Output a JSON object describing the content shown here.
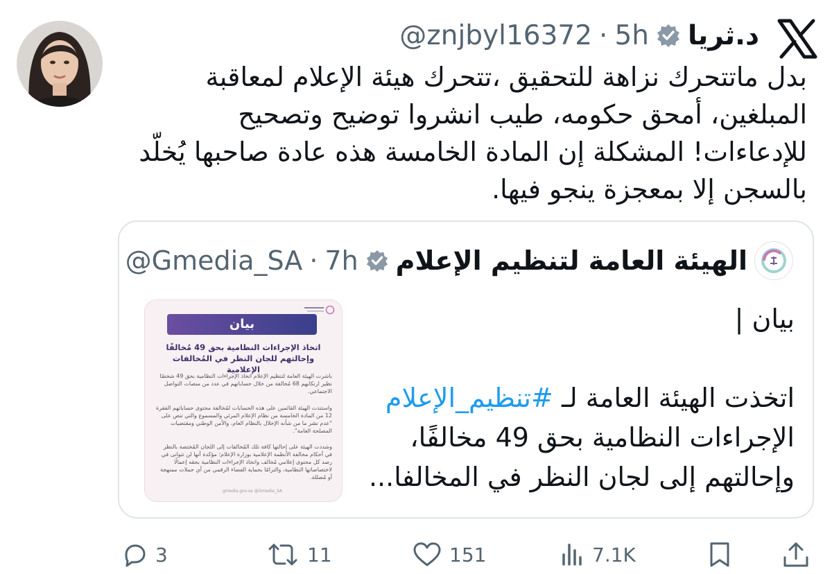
{
  "tweet": {
    "author_name": "د.ثريا",
    "handle": "@znjbyl16372",
    "separator": "·",
    "time": "5h",
    "text_lines": [
      "بدل ماتتحرك نزاهة للتحقيق ،تتحرك هيئة الإعلام لمعاقبة",
      "المبلغين، أمحق حكومه، طيب انشروا توضيح وتصحيح",
      "للإدعاءات! المشكلة إن المادة الخامسة هذه عادة صاحبها يُخلّد",
      "بالسجن إلا بمعجزة ينجو فيها."
    ]
  },
  "quote": {
    "author_name": "الهيئة العامة لتنظيم الإعلام",
    "handle": "@Gmedia_SA",
    "separator": "·",
    "time": "7h",
    "line1": "بيان |",
    "line2_prefix": "اتخذت الهيئة العامة لـ",
    "hashtag": "#تنظيم_الإعلام",
    "line3": "الإجراءات النظامية بحق 49 مخالفًا،",
    "line4": "وإحالتهم إلى لجان النظر في المخالفا..."
  },
  "statement_image": {
    "banner": "بيان",
    "title": "اتخاذ الإجراءات النظامية بحق 49 مُخالفًا وإحالتهم للجان النظر في المُخالفات الإعلامية",
    "paragraphs": [
      "باشرت الهيئة العامة لتنظيم الإعلام اتخاذ الإجراءات النظامية بحق 49 شخصًا نظير ارتكابهم 68 مُخالفة من خلال حساباتهم في عدد من منصات التواصل الاجتماعي.",
      "واستندت الهيئة القائمين على هذه الحسابات لمُخالفة محتوى حساباتهم الفقرة 12 من المادة الخامسة من نظام الإعلام المرئي والمسموع والتي تنص على \"عدم نشر ما من شأنه الإخلال بالنظام العام، والأمن الوطني ومقتضيات المصلحة العامة\".",
      "وشددت الهيئة على إحالتها كافة تلك المُخالفات إلى اللجان المُختصة بالنظر في أحكام مخالفة الأنظمة الإعلامية بوزارة الإعلام؛ مؤكدة أنها لن تتوانى في رصد كل محتوى إعلامي مُخالف واتخاذ الإجراءات النظامية بحقه إعمالًا لاختصاصاتها النظامية، والتزامًا بحماية الفضاء الرقمي من أي حملات ممنهجة أو مُضللة."
    ],
    "footer": "gmedia.gov.sa  @Gmedia_SA"
  },
  "actions": {
    "replies": "3",
    "retweets": "11",
    "likes": "151",
    "views": "7.1K"
  },
  "colors": {
    "link": "#1d9bf0",
    "verified": "#8b98a5",
    "muted": "#536471",
    "text": "#0f1419"
  }
}
